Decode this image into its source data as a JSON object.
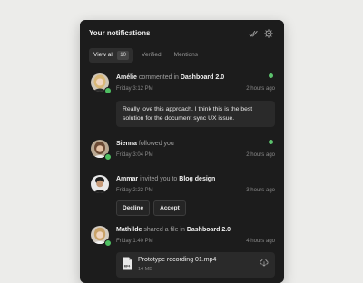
{
  "panel": {
    "title": "Your notifications",
    "icons": [
      "mark-all-read-icon",
      "settings-gear-icon"
    ]
  },
  "tabs": [
    {
      "label": "View all",
      "count": "10",
      "active": true
    },
    {
      "label": "Verified"
    },
    {
      "label": "Mentions"
    }
  ],
  "notifications": [
    {
      "name": "Amélie",
      "action": "commented in",
      "target": "Dashboard 2.0",
      "time": "Friday 3:12 PM",
      "ago": "2 hours ago",
      "unread": true,
      "comment": "Really love this approach. I think this is the best solution for the document sync UX issue."
    },
    {
      "name": "Sienna",
      "action": "followed you",
      "time": "Friday 3:04 PM",
      "ago": "2 hours ago",
      "unread": true
    },
    {
      "name": "Ammar",
      "action": "invited you to",
      "target": "Blog design",
      "time": "Friday 2:22 PM",
      "ago": "3 hours ago",
      "buttons": {
        "decline": "Decline",
        "accept": "Accept"
      }
    },
    {
      "name": "Mathilde",
      "action": "shared a file in",
      "target": "Dashboard 2.0",
      "time": "Friday 1:40 PM",
      "ago": "4 hours ago",
      "file": {
        "name": "Prototype recording 01.mp4",
        "size": "14 MB",
        "type": "MP4"
      }
    }
  ],
  "colors": {
    "panel_bg": "#1c1c1c",
    "page_bg": "#ececea",
    "online": "#4fbf62",
    "unread": "#5cc26d"
  }
}
